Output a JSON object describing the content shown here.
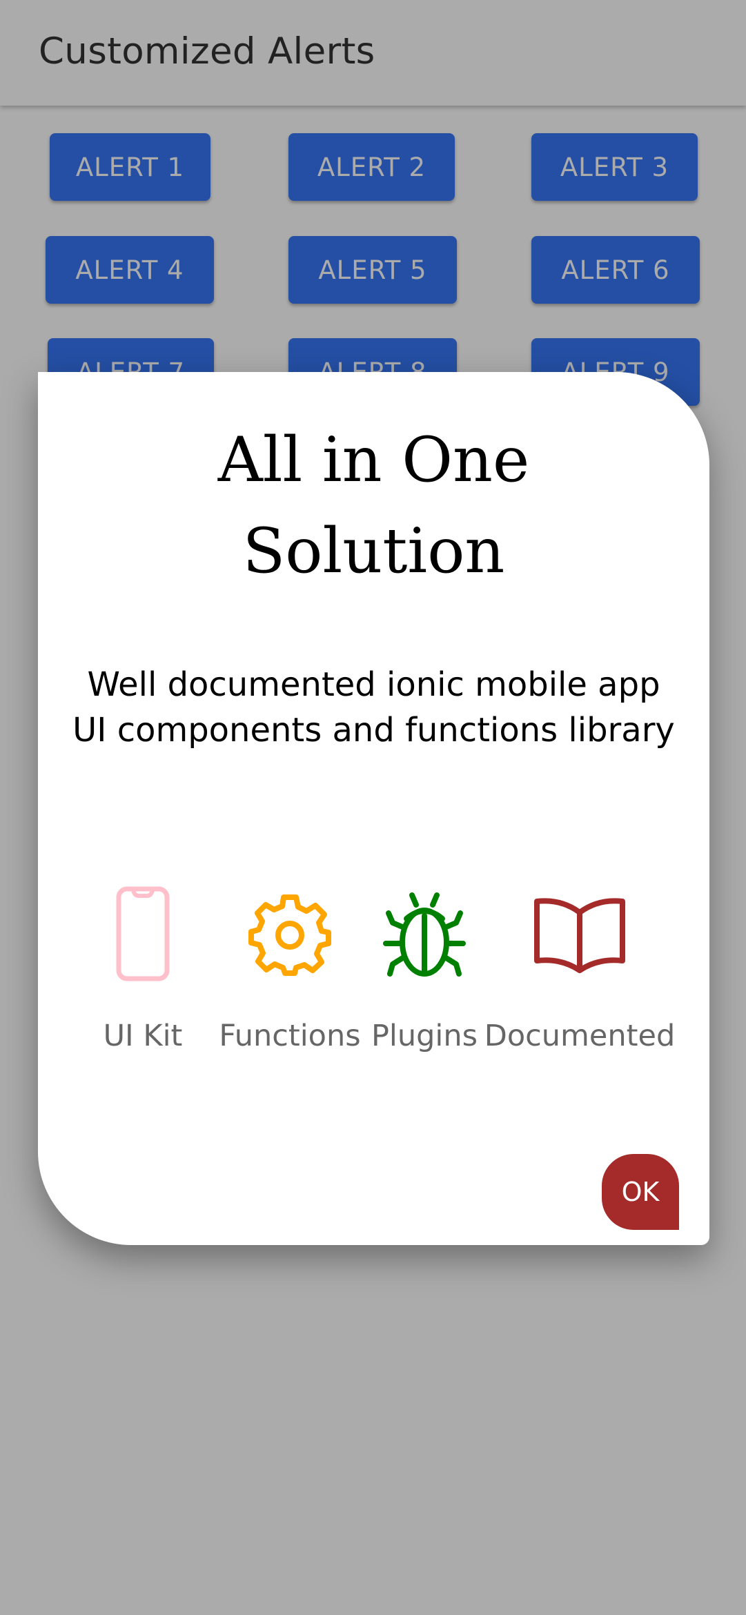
{
  "header": {
    "title": "Customized Alerts"
  },
  "alerts": {
    "buttons": [
      {
        "label": "ALERT 1"
      },
      {
        "label": "ALERT 2"
      },
      {
        "label": "ALERT 3"
      },
      {
        "label": "ALERT 4"
      },
      {
        "label": "ALERT 5"
      },
      {
        "label": "ALERT 6"
      },
      {
        "label": "ALERT 7"
      },
      {
        "label": "ALERT 8"
      },
      {
        "label": "ALERT 9"
      }
    ]
  },
  "dialog": {
    "title_line1": "All in One",
    "title_line2": "Solution",
    "message": "Well documented ionic mobile app UI components and functions library",
    "features": [
      {
        "label": "UI Kit",
        "icon": "phone-icon",
        "color": "#ffc0cb"
      },
      {
        "label": "Functions",
        "icon": "gear-icon",
        "color": "#ffa500"
      },
      {
        "label": "Plugins",
        "icon": "bug-icon",
        "color": "#008000"
      },
      {
        "label": "Documented",
        "icon": "book-icon",
        "color": "#a52a2a"
      }
    ],
    "ok_label": "OK"
  },
  "colors": {
    "alert_button": "#3677f5",
    "ok_button": "#a52a2a",
    "backdrop": "rgba(0,0,0,0.33)"
  }
}
